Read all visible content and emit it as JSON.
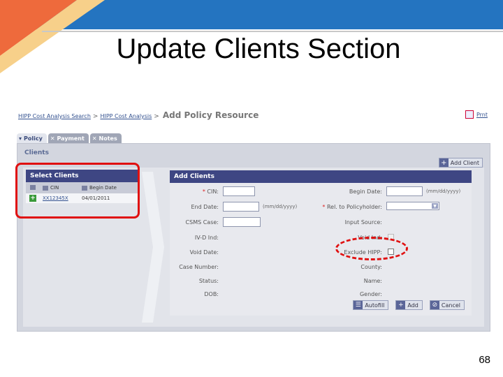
{
  "slide": {
    "title": "Update Clients Section",
    "page_number": "68",
    "colors": {
      "orange": "#ee6a3c",
      "yellow": "#f7c97a",
      "blue": "#2474c0",
      "highlight": "#e01010"
    }
  },
  "breadcrumb": {
    "items": [
      "HIPP Cost Analysis Search",
      "HIPP Cost Analysis"
    ],
    "separator": ">",
    "current": "Add Policy Resource"
  },
  "print_label": "Prnt",
  "tabs": [
    {
      "label": "Policy",
      "icon": "chevron-down-icon"
    },
    {
      "label": "Payment",
      "icon": "close-icon"
    },
    {
      "label": "Notes",
      "icon": "close-icon"
    }
  ],
  "clients": {
    "section_label": "Clients",
    "add_client_button": "Add Client",
    "select_clients": {
      "header": "Select Clients",
      "columns": [
        "CIN",
        "Begin Date"
      ],
      "rows": [
        {
          "cin": "XX12345X",
          "begin_date": "04/01/2011"
        }
      ]
    },
    "add_clients": {
      "header": "Add Clients",
      "fields": {
        "cin": {
          "label": "CIN:",
          "required": "*"
        },
        "begin_date": {
          "label": "Begin Date:",
          "hint": "(mm/dd/yyyy)"
        },
        "end_date": {
          "label": "End Date:",
          "hint": "(mm/dd/yyyy)"
        },
        "rel_policyholder": {
          "label": "Rel. to Policyholder:",
          "required": "*"
        },
        "csms_case": {
          "label": "CSMS Case:"
        },
        "input_source": {
          "label": "Input Source:"
        },
        "ivd_ind": {
          "label": "IV-D Ind:"
        },
        "void_ind": {
          "label": "Void Ind:"
        },
        "void_date": {
          "label": "Void Date:"
        },
        "exclude_hipp": {
          "label": "Exclude HIPP:"
        },
        "case_number": {
          "label": "Case Number:"
        },
        "county": {
          "label": "County:"
        },
        "status": {
          "label": "Status:"
        },
        "name": {
          "label": "Name:"
        },
        "dob": {
          "label": "DOB:"
        },
        "gender": {
          "label": "Gender:"
        }
      },
      "buttons": {
        "autofill": "Autofill",
        "add": "Add",
        "cancel": "Cancel"
      }
    }
  }
}
